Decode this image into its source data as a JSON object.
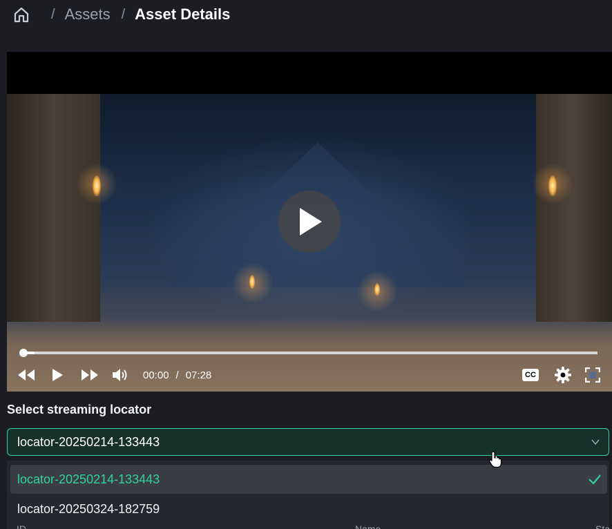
{
  "breadcrumb": {
    "home_icon": "home-icon",
    "items": [
      "Assets",
      "Asset Details"
    ],
    "separator": "/"
  },
  "player": {
    "current_time": "00:00",
    "duration": "07:28",
    "time_separator": "/",
    "progress_fraction": 0.005,
    "icons": {
      "rewind": "rewind-icon",
      "play": "play-icon",
      "fast_forward": "fast-forward-icon",
      "volume": "volume-icon",
      "captions": "CC",
      "settings": "gear-icon",
      "fullscreen": "fullscreen-icon",
      "big_play": "play-circle-icon"
    }
  },
  "locator": {
    "label": "Select streaming locator",
    "selected_value": "locator-20250214-133443",
    "options": [
      {
        "label": "locator-20250214-133443",
        "selected": true
      },
      {
        "label": "locator-20250324-182759",
        "selected": false
      }
    ]
  },
  "table_peek": {
    "headers": [
      "ID",
      "Name",
      "Sta"
    ]
  },
  "colors": {
    "accent": "#2fd59a",
    "background": "#1b1d22",
    "select_bg": "#163129"
  }
}
